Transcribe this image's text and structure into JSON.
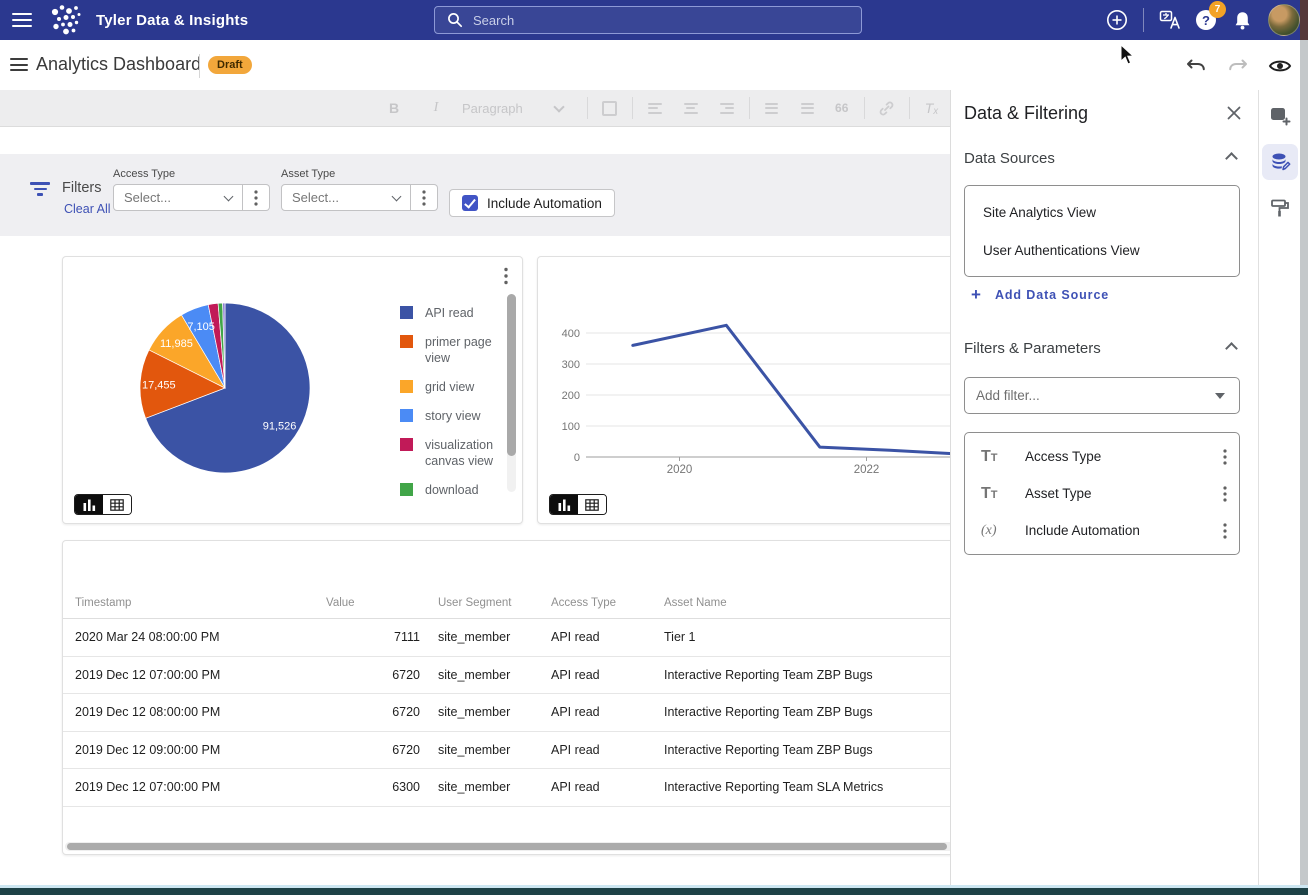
{
  "colors": {
    "navbar": "#2B388F",
    "accent": "#3E51B5",
    "badge_bg": "#F2A73B",
    "badge_text": "#3F2A00",
    "checkbox": "#4154C5",
    "line_series": "#3B53A5",
    "teal_strip": "#1E4247"
  },
  "topnav": {
    "title": "Tyler Data & Insights",
    "search_placeholder": "Search",
    "help_badge_count": "7",
    "icon_names": [
      "menu-icon",
      "tyler-logo",
      "search-icon",
      "add-circle-icon",
      "translate-icon",
      "help-icon",
      "notifications-bell-icon",
      "user-avatar"
    ]
  },
  "header": {
    "title": "Analytics Dashboard",
    "status_badge": "Draft",
    "icon_names": [
      "menu-icon",
      "undo-icon",
      "redo-icon",
      "preview-eye-icon"
    ],
    "redo_disabled": true
  },
  "toolbar": {
    "disabled": true,
    "paragraph_label": "Paragraph",
    "icon_names": [
      "bold",
      "italic",
      "paragraph-select",
      "insert-box",
      "align-left",
      "align-center",
      "align-right",
      "numbered-list",
      "bulleted-list",
      "blockquote",
      "link",
      "clear-formatting"
    ],
    "blockquote_glyph": "66",
    "link_glyph": "link",
    "clear_glyph": "Tₓ"
  },
  "filter_bar": {
    "title": "Filters",
    "clear_all_label": "Clear All",
    "fields": [
      {
        "label": "Access Type",
        "placeholder": "Select..."
      },
      {
        "label": "Asset Type",
        "placeholder": "Select..."
      }
    ],
    "checkbox": {
      "label": "Include Automation",
      "checked": true
    }
  },
  "chart_data": [
    {
      "type": "pie",
      "title": "",
      "legend_position": "right",
      "slices": [
        {
          "label": "API read",
          "value": 91526,
          "value_label": "91,526",
          "color": "#3B53A5"
        },
        {
          "label": "primer page view",
          "value": 17455,
          "value_label": "17,455",
          "color": "#E2570D"
        },
        {
          "label": "grid view",
          "value": 11985,
          "value_label": "11,985",
          "color": "#FBA629"
        },
        {
          "label": "story view",
          "value": 7105,
          "value_label": "7,105",
          "color": "#4B8BF5"
        },
        {
          "label": "visualization canvas view",
          "value": 2500,
          "value_label": "",
          "color": "#C11A58"
        },
        {
          "label": "download",
          "value": 1100,
          "value_label": "",
          "color": "#41A548"
        },
        {
          "label": "",
          "value": 600,
          "value_label": "",
          "color": "#8F7FD4"
        }
      ]
    },
    {
      "type": "line",
      "title": "",
      "grid": true,
      "xlim": [
        2019.4,
        2023.05
      ],
      "ylim": [
        0,
        430
      ],
      "yticks": [
        0,
        100,
        200,
        300,
        400
      ],
      "xticks": [
        2020,
        2022
      ],
      "series": [
        {
          "name": "",
          "color": "#3B53A5",
          "points": [
            [
              2019.5,
              360
            ],
            [
              2020.5,
              425
            ],
            [
              2021.5,
              32
            ],
            [
              2022.25,
              22
            ],
            [
              2022.96,
              10
            ]
          ]
        }
      ]
    },
    {
      "type": "table",
      "columns": [
        "Timestamp",
        "Value",
        "User Segment",
        "Access Type",
        "Asset Name"
      ],
      "rows": [
        [
          "2020 Mar 24 08:00:00 PM",
          "7111",
          "site_member",
          "API read",
          "Tier 1"
        ],
        [
          "2019 Dec 12 07:00:00 PM",
          "6720",
          "site_member",
          "API read",
          "Interactive Reporting Team ZBP Bugs"
        ],
        [
          "2019 Dec 12 08:00:00 PM",
          "6720",
          "site_member",
          "API read",
          "Interactive Reporting Team ZBP Bugs"
        ],
        [
          "2019 Dec 12 09:00:00 PM",
          "6720",
          "site_member",
          "API read",
          "Interactive Reporting Team ZBP Bugs"
        ],
        [
          "2019 Dec 12 07:00:00 PM",
          "6300",
          "site_member",
          "API read",
          "Interactive Reporting Team SLA Metrics"
        ]
      ]
    }
  ],
  "widget_controls": {
    "toggle_icon_names": [
      "bar-chart-view-icon",
      "table-view-icon"
    ],
    "menu_icon_name": "kebab-menu-icon"
  },
  "panel": {
    "title": "Data & Filtering",
    "data_sources": {
      "heading": "Data Sources",
      "items": [
        "Site Analytics View",
        "User Authentications View"
      ],
      "add_label": "Add Data Source"
    },
    "filters_params": {
      "heading": "Filters & Parameters",
      "add_filter_placeholder": "Add filter...",
      "items": [
        {
          "icon": "text-type",
          "icon_glyph_big": "T",
          "icon_glyph_small": "T",
          "label": "Access Type"
        },
        {
          "icon": "text-type",
          "icon_glyph_big": "T",
          "icon_glyph_small": "T",
          "label": "Asset Type"
        },
        {
          "icon": "formula",
          "icon_glyph": "(x)",
          "label": "Include Automation"
        }
      ]
    }
  },
  "rail": {
    "icon_names": [
      "add-card-icon",
      "data-sources-icon",
      "style-paint-roller-icon"
    ],
    "active_index": 1
  }
}
